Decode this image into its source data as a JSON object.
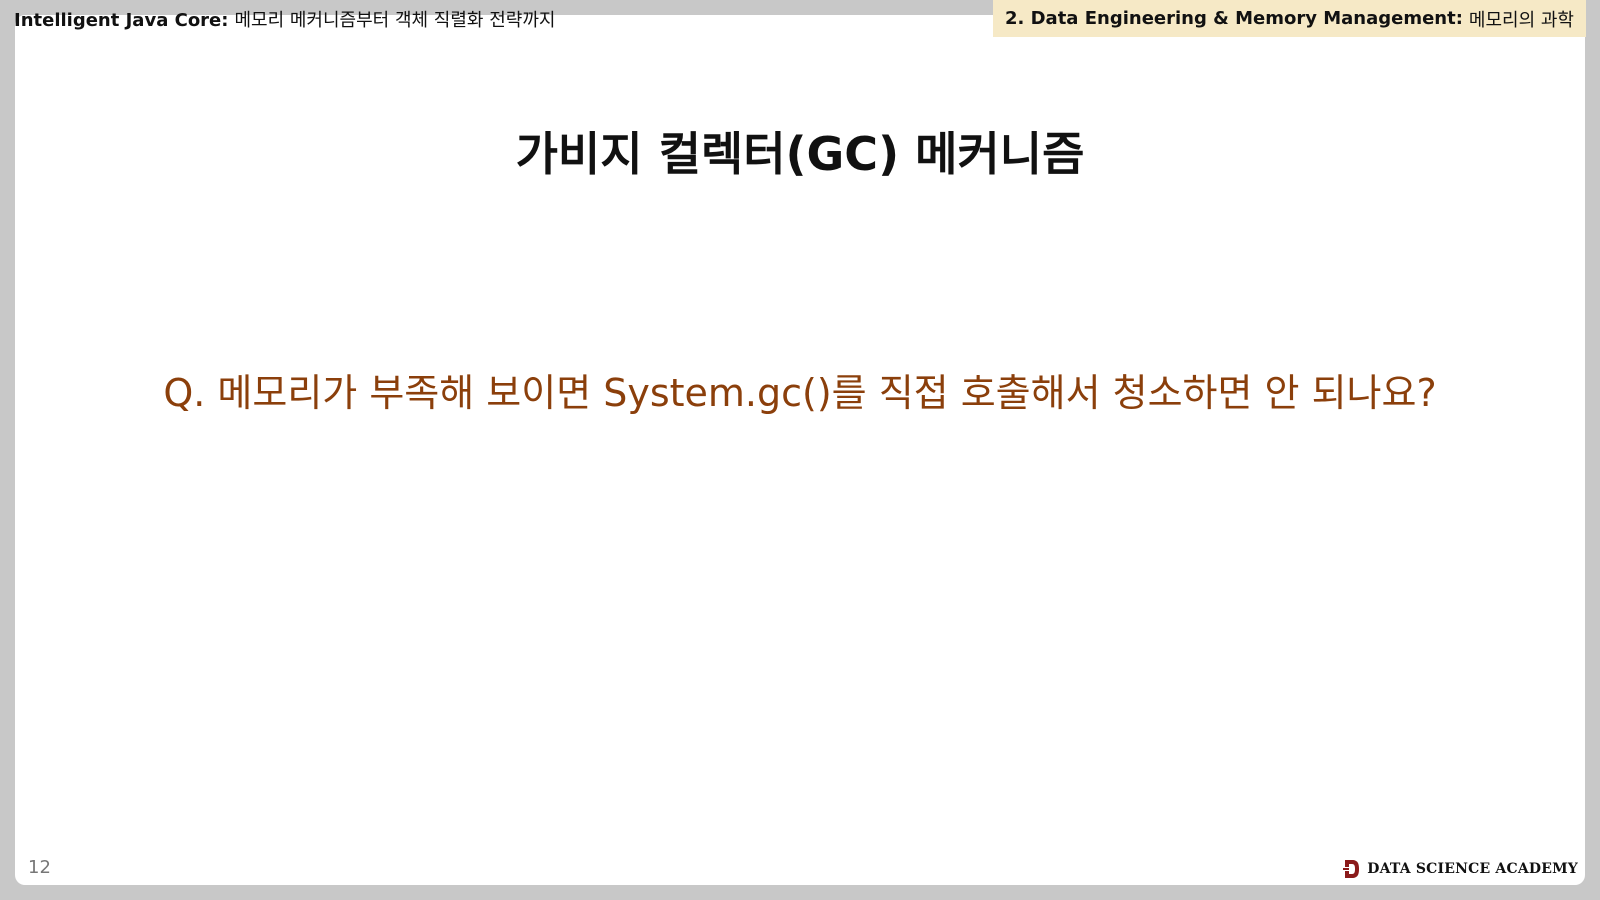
{
  "header": {
    "left_bold": "Intelligent Java Core:",
    "left_text": "메모리 메커니즘부터 객체 직렬화 전략까지",
    "right_bold": "2. Data Engineering & Memory Management:",
    "right_text": "메모리의 과학"
  },
  "slide": {
    "title": "가비지 컬렉터(GC) 메커니즘",
    "question": "Q. 메모리가 부족해 보이면 System.gc()를 직접 호출해서 청소하면 안 되나요?",
    "page_number": "12"
  },
  "brand": {
    "name": "DATA SCIENCE ACADEMY",
    "icon": "logo-d-icon",
    "color": "#8b1a1a"
  },
  "colors": {
    "question": "#8b3f0b",
    "header_badge_bg": "#f6e9c6",
    "frame": "#c8c8c8"
  }
}
